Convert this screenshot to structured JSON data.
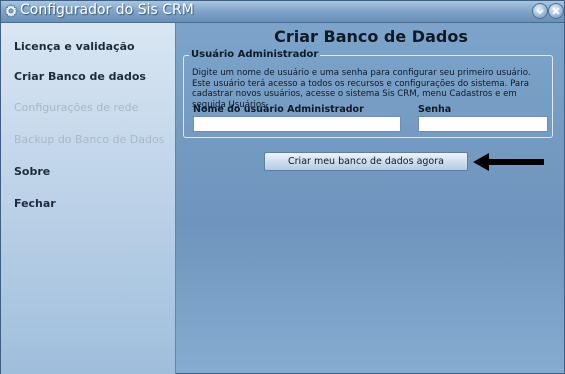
{
  "window": {
    "title": "Configurador do Sis CRM"
  },
  "sidebar": {
    "items": [
      {
        "label": "Licença e validação",
        "enabled": true
      },
      {
        "label": "Criar Banco de dados",
        "enabled": true
      },
      {
        "label": "Configurações de rede",
        "enabled": false
      },
      {
        "label": "Backup do Banco de Dados",
        "enabled": false
      },
      {
        "label": "Sobre",
        "enabled": true
      },
      {
        "label": "Fechar",
        "enabled": true
      }
    ]
  },
  "main": {
    "title": "Criar Banco de Dados",
    "group_label": "Usuário Administrador",
    "description": "Digite um nome de usuário e uma senha para configurar seu primeiro usuário. Este usuário terá acesso a todos os recursos e configurações do sistema. Para cadastrar novos usuários, acesse o sistema Sis CRM, menu Cadastros e em seguida Usuários.",
    "username_label": "Nome do usuário Administrador",
    "username_value": "",
    "password_label": "Senha",
    "password_value": "",
    "create_button_label": "Criar meu banco de dados agora"
  },
  "icons": {
    "title": "gear-icon",
    "minimize": "minimize-icon",
    "close": "close-icon",
    "pointer": "arrow-left-icon"
  },
  "colors": {
    "panel_background": "#6d95bd",
    "sidebar_background": "#c2d6ea",
    "disabled_text": "#a8b8c9",
    "arrow": "#000000"
  }
}
